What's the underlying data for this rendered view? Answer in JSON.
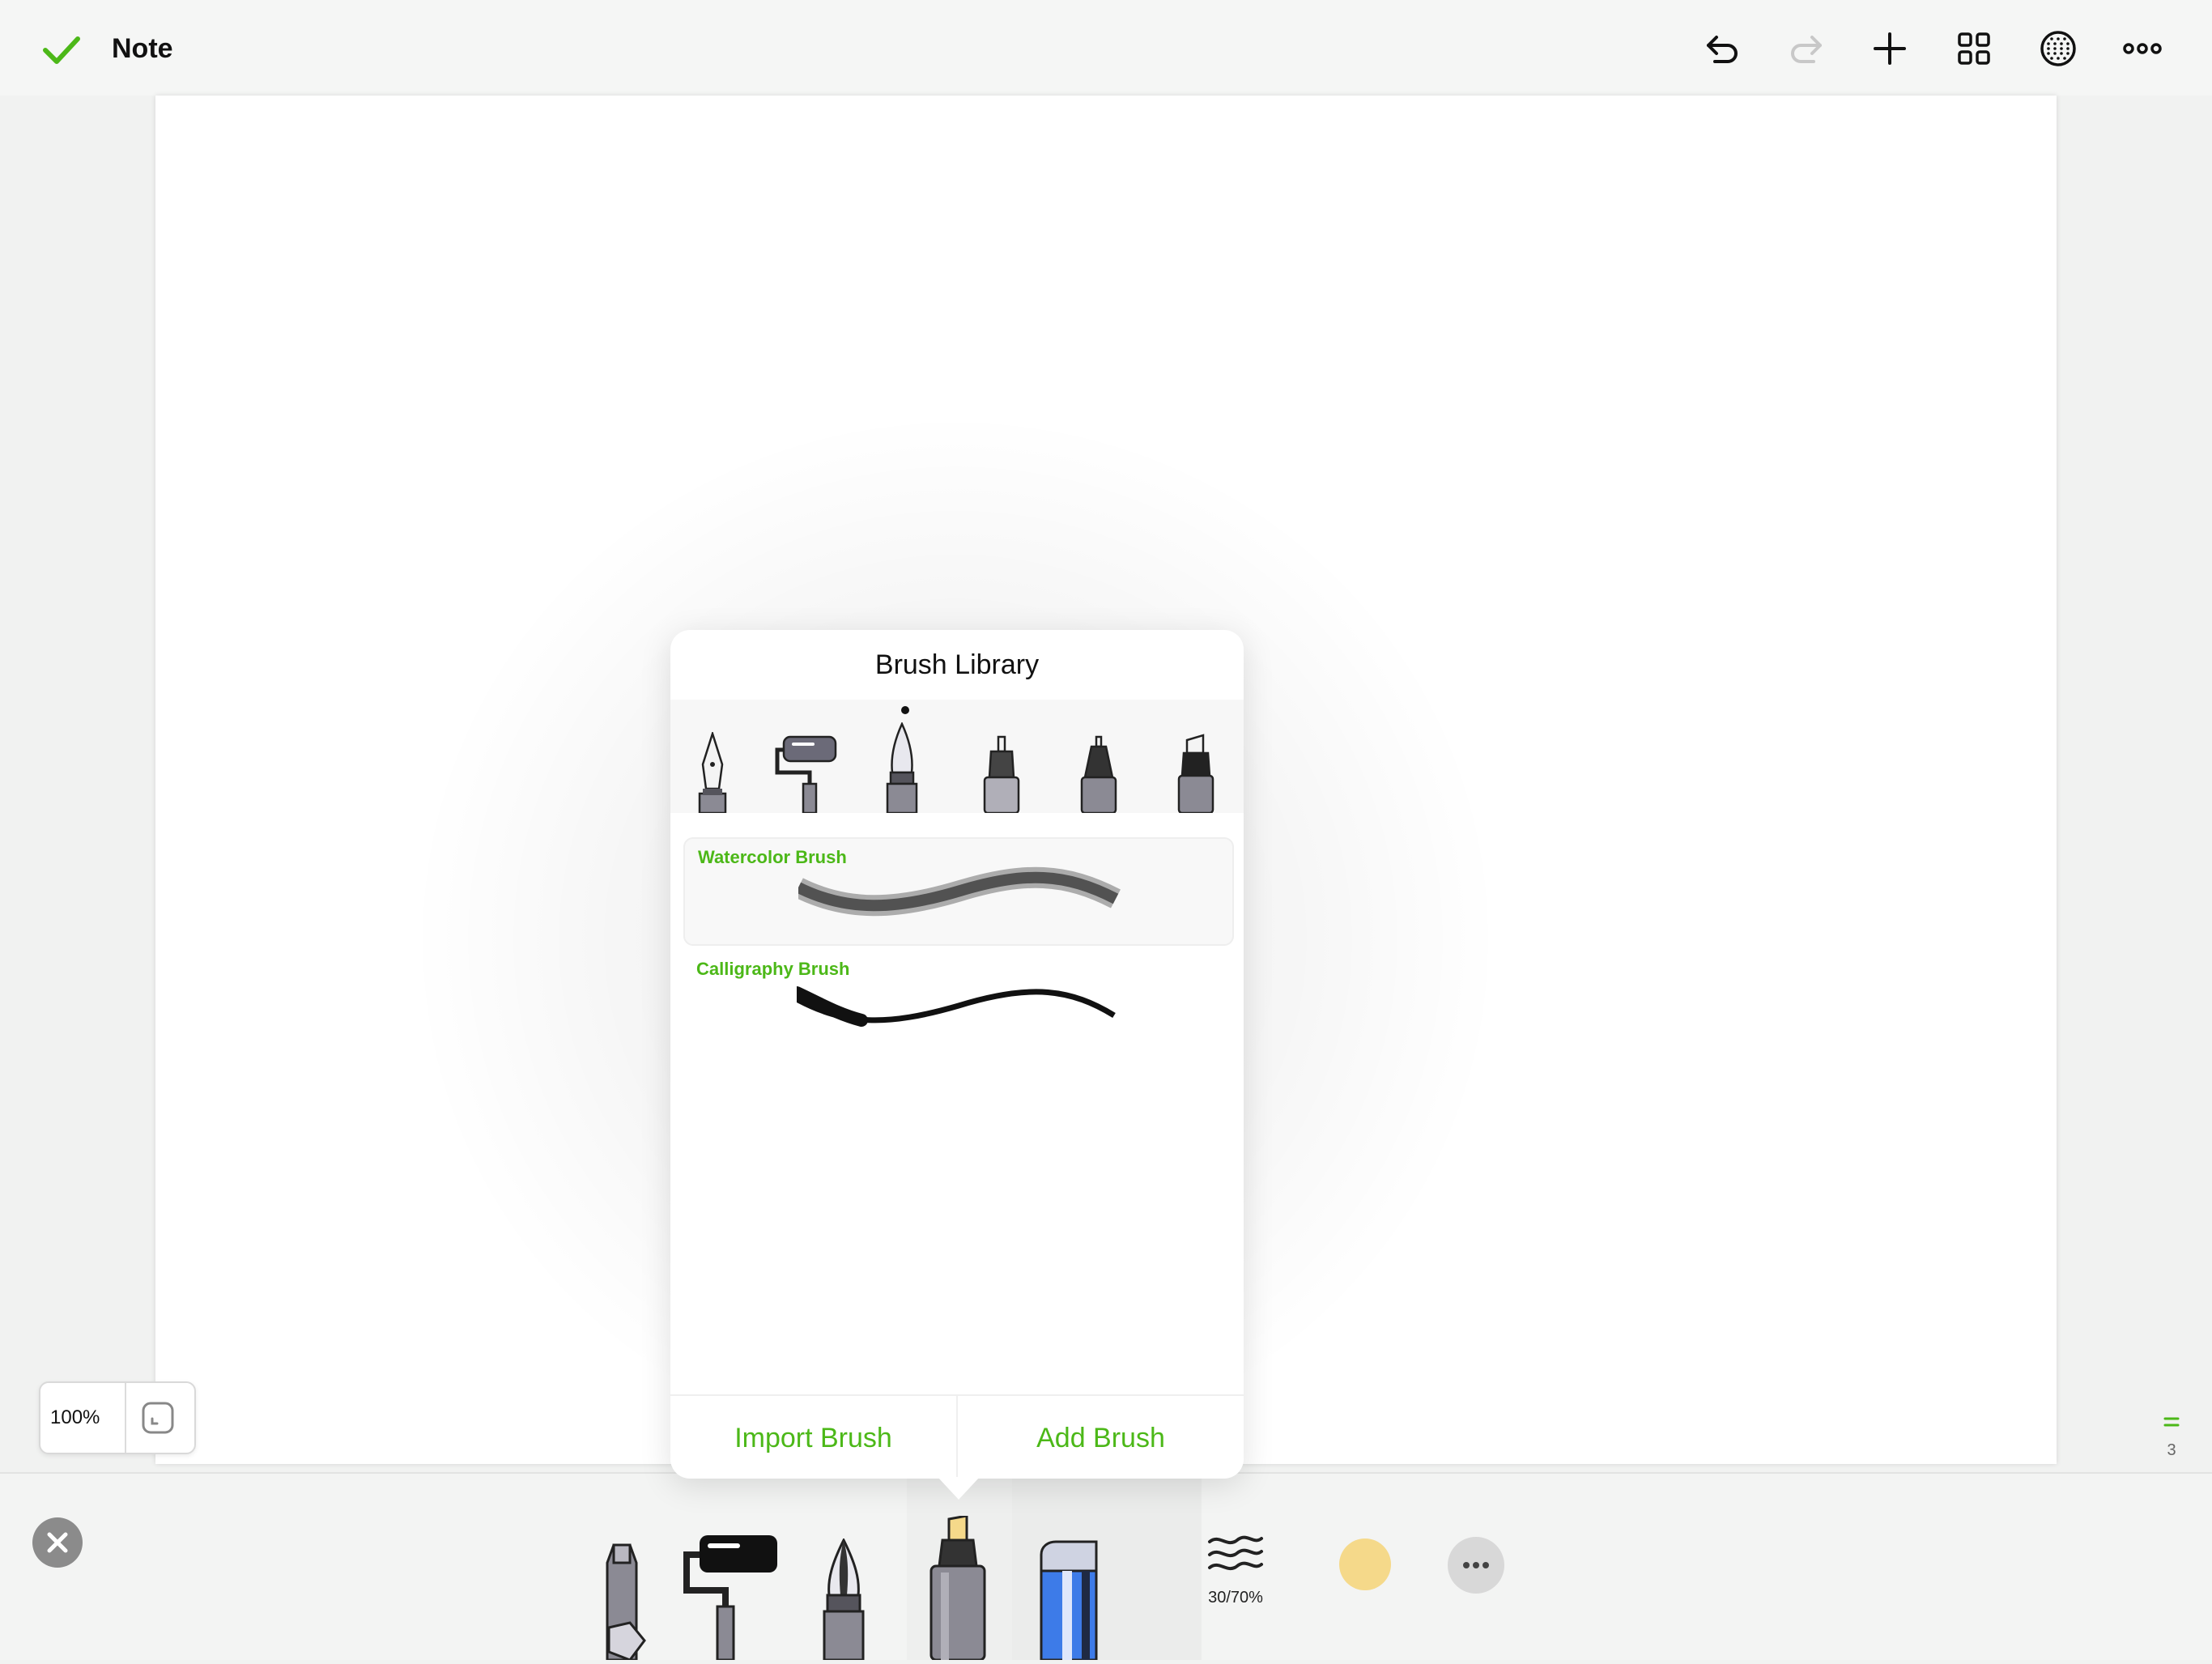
{
  "header": {
    "title": "Note",
    "icons": {
      "done": "checkmark-icon",
      "undo": "undo-icon",
      "redo": "redo-icon",
      "add": "plus-icon",
      "pages": "grid-icon",
      "paper": "dotted-globe-icon",
      "more": "ellipsis-icon"
    }
  },
  "zoom": {
    "label": "100%"
  },
  "page_indicator": {
    "number": "3"
  },
  "brush_library": {
    "title": "Brush Library",
    "brushes": [
      {
        "name": "Watercolor Brush",
        "selected": true
      },
      {
        "name": "Calligraphy Brush",
        "selected": false
      }
    ],
    "import_label": "Import Brush",
    "add_label": "Add Brush"
  },
  "toolbar": {
    "size_opacity": "30/70%",
    "color": "#f5d98a"
  },
  "colors": {
    "accent": "#4cb818",
    "redo_disabled": "#c8c8c8"
  }
}
